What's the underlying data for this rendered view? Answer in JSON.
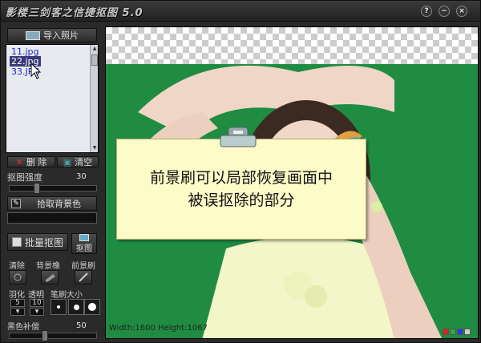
{
  "app": {
    "title": "影楼三剑客之信捷抠图 5.0"
  },
  "titlebar": {
    "help": "?",
    "minimize": "−",
    "close": "×"
  },
  "sidebar": {
    "import_label": "导入照片",
    "files": [
      "11.jpg",
      "22.jpg",
      "33.JPG"
    ],
    "selected_index": 1,
    "delete_label": "删 除",
    "clear_label": "清空",
    "matting_strength_label": "抠图强度",
    "matting_strength_value": "30",
    "pick_bg_label": "拾取背景色",
    "batch_label": "批量抠图",
    "matting_label": "抠图",
    "tools": [
      "清除",
      "背景橡",
      "前景刷"
    ],
    "feather_label": "羽化",
    "transparency_label": "透明",
    "brush_size_label": "笔刷大小",
    "feather_value": "5",
    "transparency_value": "10",
    "black_comp_label": "黑色补偿",
    "black_comp_value": "50"
  },
  "canvas": {
    "tip_line1": "前景刷可以局部恢复画面中",
    "tip_line2": "被误抠除的部分",
    "size_info": "Width:1600  Height:1067",
    "swatch_colors": [
      "#e02020",
      "#20b040",
      "#2040e0",
      "#d0d0d0"
    ]
  }
}
